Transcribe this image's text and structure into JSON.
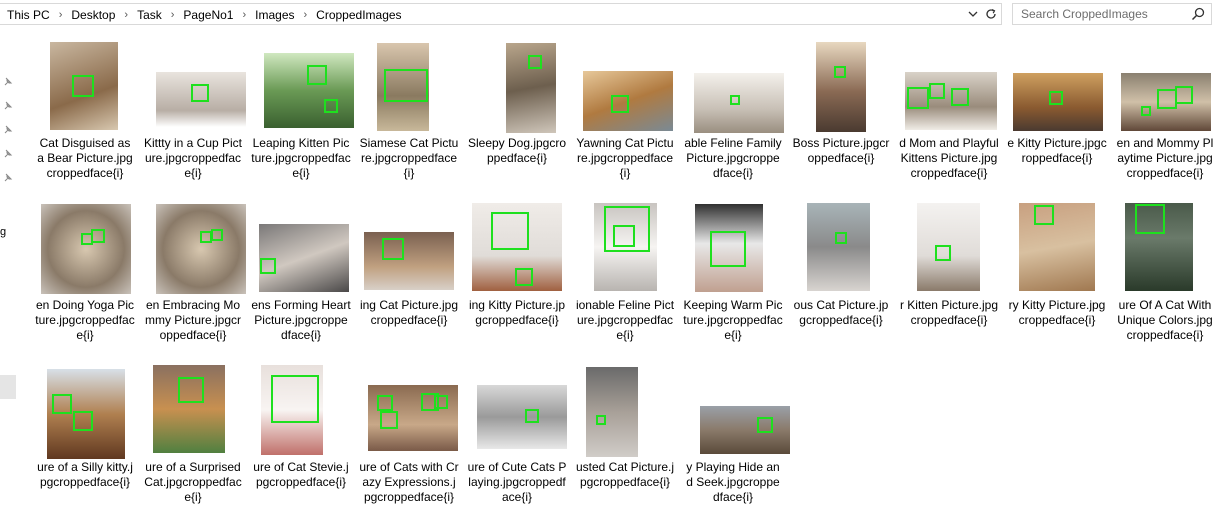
{
  "breadcrumb": [
    "This PC",
    "Desktop",
    "Task",
    "PageNo1",
    "Images",
    "CroppedImages"
  ],
  "search": {
    "placeholder": "Search CroppedImages"
  },
  "nav": {
    "partial_label": "g"
  },
  "items": [
    {
      "label": "Cat Disguised as a Bear Picture.jpgcroppedface{i}"
    },
    {
      "label": "Kittty in a Cup Picture.jpgcroppedface{i}"
    },
    {
      "label": "Leaping Kitten Picture.jpgcroppedface{i}"
    },
    {
      "label": "Siamese Cat Picture.jpgcroppedface{i}"
    },
    {
      "label": "Sleepy Dog.jpgcroppedface{i}"
    },
    {
      "label": "Yawning Cat Picture.jpgcroppedface{i}"
    },
    {
      "label": "able Feline Family Picture.jpgcroppedface{i}"
    },
    {
      "label": "Boss Picture.jpgcroppedface{i}"
    },
    {
      "label": "d Mom and Playful Kittens Picture.jpgcroppedface{i}"
    },
    {
      "label": "e Kitty Picture.jpgcroppedface{i}"
    },
    {
      "label": "en and Mommy Playtime Picture.jpgcroppedface{i}"
    },
    {
      "label": "en Doing Yoga Picture.jpgcroppedface{i}"
    },
    {
      "label": "en Embracing Mommy Picture.jpgcroppedface{i}"
    },
    {
      "label": "ens Forming Heart Picture.jpgcroppedface{i}"
    },
    {
      "label": "ing Cat Picture.jpgcroppedface{i}"
    },
    {
      "label": "ing Kitty Picture.jpgcroppedface{i}"
    },
    {
      "label": "ionable Feline Picture.jpgcroppedface{i}"
    },
    {
      "label": "Keeping Warm Picture.jpgcroppedface{i}"
    },
    {
      "label": "ous Cat Picture.jpgcroppedface{i}"
    },
    {
      "label": "r Kitten Picture.jpgcroppedface{i}"
    },
    {
      "label": "ry Kitty Picture.jpgcroppedface{i}"
    },
    {
      "label": "ure Of A Cat With Unique Colors.jpgcroppedface{i}"
    },
    {
      "label": "ure of a Silly kitty.jpgcroppedface{i}"
    },
    {
      "label": "ure of a Surprised Cat.jpgcroppedface{i}"
    },
    {
      "label": "ure of Cat Stevie.jpgcroppedface{i}"
    },
    {
      "label": "ure of Cats with Crazy Expressions.jpgcroppedface{i}"
    },
    {
      "label": "ure of Cute Cats Playing.jpgcroppedface{i}"
    },
    {
      "label": "usted Cat Picture.jpgcroppedface{i}"
    },
    {
      "label": "y Playing Hide and Seek.jpgcroppedface{i}"
    }
  ]
}
